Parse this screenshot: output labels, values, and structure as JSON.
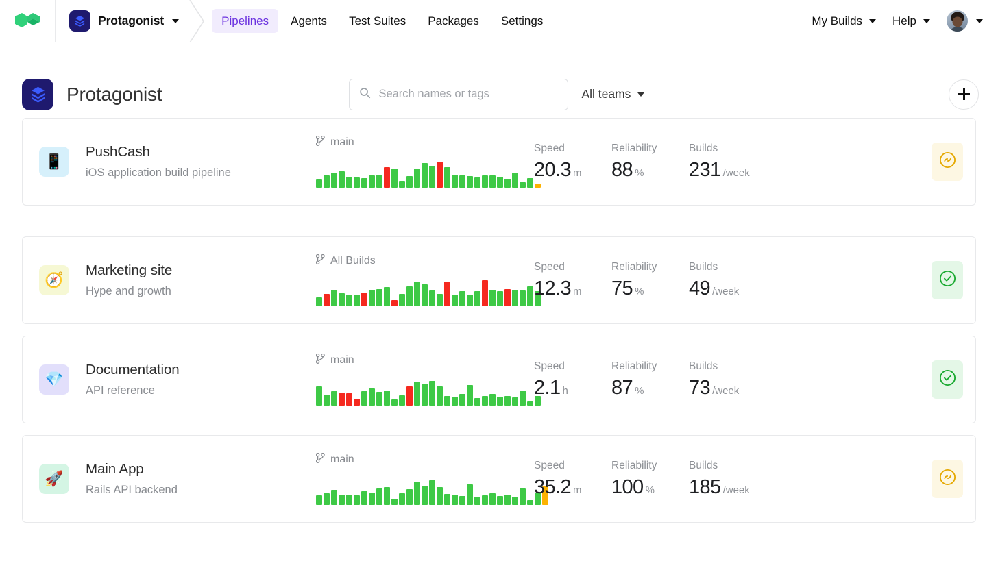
{
  "topnav": {
    "logo_icon": "buildkite-logo-icon",
    "org": {
      "name": "Protagonist",
      "avatar_icon": "org-avatar-icon",
      "caret_icon": "chevron-down-icon"
    },
    "tabs": [
      {
        "label": "Pipelines",
        "active": true
      },
      {
        "label": "Agents",
        "active": false
      },
      {
        "label": "Test Suites",
        "active": false
      },
      {
        "label": "Packages",
        "active": false
      },
      {
        "label": "Settings",
        "active": false
      }
    ],
    "right": {
      "my_builds": "My Builds",
      "help": "Help",
      "avatar_icon": "user-avatar-icon",
      "caret_icon": "chevron-down-icon"
    }
  },
  "page_header": {
    "title": "Protagonist",
    "avatar_icon": "org-avatar-icon",
    "search": {
      "placeholder": "Search names or tags",
      "value": "",
      "icon": "search-icon"
    },
    "teams_filter": {
      "label": "All teams",
      "caret_icon": "chevron-down-icon"
    },
    "add_button": {
      "icon": "plus-icon",
      "label": ""
    }
  },
  "stat_labels": {
    "speed": "Speed",
    "reliability": "Reliability",
    "builds": "Builds"
  },
  "colors": {
    "accent": "#6b32e0",
    "bar_passed": "#3ec946",
    "bar_failed": "#f5291f",
    "bar_running": "#fcb201",
    "badge_running_bg": "#fdf7e3",
    "badge_running_fg": "#e5a800",
    "badge_passed_bg": "#e4f7e7",
    "badge_passed_fg": "#18a92f"
  },
  "pipelines": [
    {
      "name": "PushCash",
      "description": "iOS application build pipeline",
      "emoji": "📱",
      "icon_bg": "#d6f0fb",
      "branch": "main",
      "branch_icon": "git-branch-icon",
      "speed": {
        "value": "20.3",
        "unit": "m"
      },
      "reliability": {
        "value": "88",
        "unit": "%"
      },
      "builds": {
        "value": "231",
        "unit": "/week"
      },
      "status": "running",
      "status_icon": "running-circle-icon",
      "chart_data": {
        "type": "bar",
        "title": "PushCash recent builds",
        "values": [
          12,
          18,
          22,
          24,
          16,
          15,
          14,
          18,
          19,
          30,
          28,
          10,
          17,
          28,
          36,
          32,
          38,
          30,
          19,
          18,
          17,
          15,
          18,
          18,
          16,
          13,
          22,
          8,
          14,
          6
        ],
        "states": [
          "passed",
          "passed",
          "passed",
          "passed",
          "passed",
          "passed",
          "passed",
          "passed",
          "passed",
          "failed",
          "passed",
          "passed",
          "passed",
          "passed",
          "passed",
          "passed",
          "failed",
          "passed",
          "passed",
          "passed",
          "passed",
          "passed",
          "passed",
          "passed",
          "passed",
          "passed",
          "passed",
          "passed",
          "passed",
          "running"
        ],
        "ylim": [
          0,
          46
        ]
      }
    },
    {
      "name": "Marketing site",
      "description": "Hype and growth",
      "emoji": "🧭",
      "icon_bg": "#f6f8d4",
      "branch": "All Builds",
      "branch_icon": "git-branch-icon",
      "speed": {
        "value": "12.3",
        "unit": "m"
      },
      "reliability": {
        "value": "75",
        "unit": "%"
      },
      "builds": {
        "value": "49",
        "unit": "/week"
      },
      "status": "passed",
      "status_icon": "check-circle-icon",
      "chart_data": {
        "type": "bar",
        "title": "Marketing site recent builds",
        "values": [
          13,
          18,
          24,
          19,
          17,
          17,
          20,
          24,
          25,
          28,
          9,
          18,
          29,
          36,
          32,
          23,
          18,
          36,
          17,
          22,
          17,
          22,
          38,
          24,
          22,
          25,
          24,
          23,
          29,
          22
        ],
        "states": [
          "passed",
          "failed",
          "passed",
          "passed",
          "passed",
          "passed",
          "failed",
          "passed",
          "passed",
          "passed",
          "failed",
          "passed",
          "passed",
          "passed",
          "passed",
          "passed",
          "passed",
          "failed",
          "passed",
          "passed",
          "passed",
          "passed",
          "failed",
          "passed",
          "passed",
          "failed",
          "passed",
          "passed",
          "passed",
          "passed"
        ],
        "ylim": [
          0,
          46
        ]
      }
    },
    {
      "name": "Documentation",
      "description": "API reference",
      "emoji": "💎",
      "icon_bg": "#e2dffb",
      "branch": "main",
      "branch_icon": "git-branch-icon",
      "speed": {
        "value": "2.1",
        "unit": "h"
      },
      "reliability": {
        "value": "87",
        "unit": "%"
      },
      "builds": {
        "value": "73",
        "unit": "/week"
      },
      "status": "passed",
      "status_icon": "check-circle-icon",
      "chart_data": {
        "type": "bar",
        "title": "Documentation recent builds",
        "values": [
          28,
          16,
          21,
          19,
          18,
          10,
          21,
          25,
          20,
          22,
          9,
          15,
          28,
          35,
          32,
          36,
          28,
          14,
          13,
          17,
          30,
          11,
          14,
          17,
          13,
          14,
          12,
          22,
          6,
          14
        ],
        "states": [
          "passed",
          "passed",
          "passed",
          "failed",
          "failed",
          "failed",
          "passed",
          "passed",
          "passed",
          "passed",
          "passed",
          "passed",
          "failed",
          "passed",
          "passed",
          "passed",
          "passed",
          "passed",
          "passed",
          "passed",
          "passed",
          "passed",
          "passed",
          "passed",
          "passed",
          "passed",
          "passed",
          "passed",
          "passed",
          "passed"
        ],
        "ylim": [
          0,
          46
        ]
      }
    },
    {
      "name": "Main App",
      "description": "Rails API backend",
      "emoji": "🚀",
      "icon_bg": "#d4f5e4",
      "branch": "main",
      "branch_icon": "git-branch-icon",
      "speed": {
        "value": "35.2",
        "unit": "m"
      },
      "reliability": {
        "value": "100",
        "unit": "%"
      },
      "builds": {
        "value": "185",
        "unit": "/week"
      },
      "status": "running",
      "status_icon": "running-circle-icon",
      "chart_data": {
        "type": "bar",
        "title": "Main App recent builds",
        "values": [
          14,
          17,
          22,
          15,
          15,
          14,
          20,
          18,
          24,
          26,
          9,
          17,
          23,
          34,
          28,
          36,
          26,
          16,
          15,
          13,
          30,
          12,
          14,
          17,
          13,
          15,
          12,
          24,
          7,
          18,
          27
        ],
        "states": [
          "passed",
          "passed",
          "passed",
          "passed",
          "passed",
          "passed",
          "passed",
          "passed",
          "passed",
          "passed",
          "passed",
          "passed",
          "passed",
          "passed",
          "passed",
          "passed",
          "passed",
          "passed",
          "passed",
          "passed",
          "passed",
          "passed",
          "passed",
          "passed",
          "passed",
          "passed",
          "passed",
          "passed",
          "passed",
          "passed",
          "running"
        ],
        "ylim": [
          0,
          46
        ]
      }
    }
  ]
}
